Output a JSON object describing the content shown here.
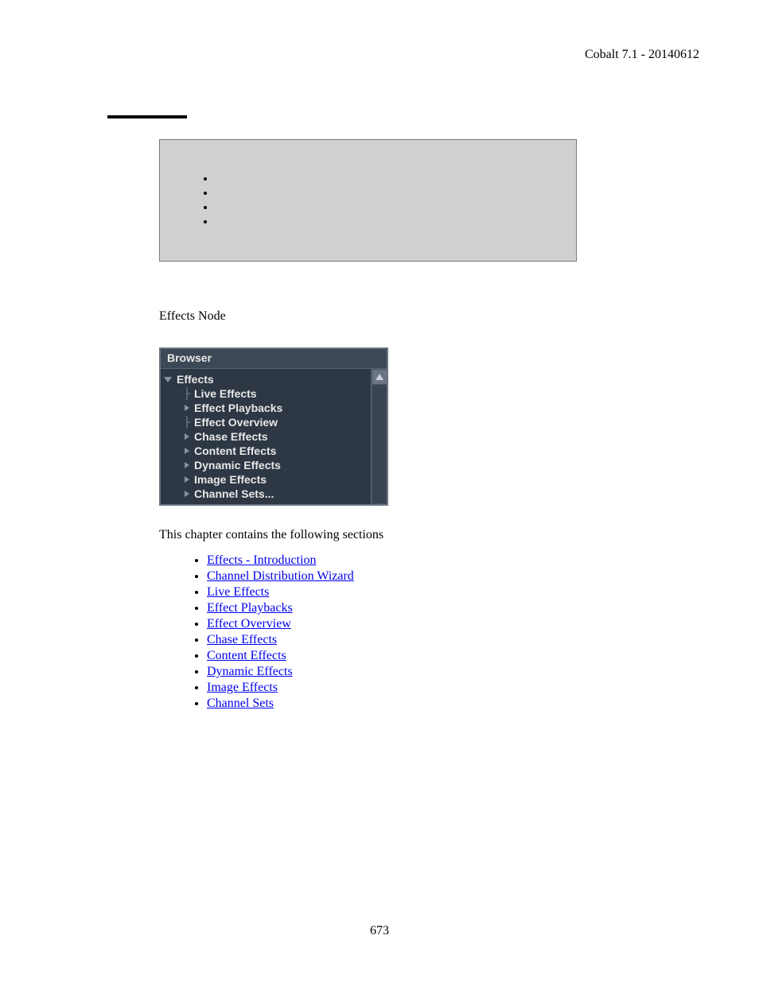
{
  "header": {
    "version_text": "Cobalt 7.1 - 20140612"
  },
  "body": {
    "effects_node_label": "Effects Node",
    "sections_intro": "This chapter contains the following sections"
  },
  "browser": {
    "title": "Browser",
    "root_label": "Effects",
    "items": [
      {
        "label": "Live Effects",
        "expandable": false
      },
      {
        "label": "Effect Playbacks",
        "expandable": true
      },
      {
        "label": "Effect Overview",
        "expandable": false
      },
      {
        "label": "Chase Effects",
        "expandable": true
      },
      {
        "label": "Content Effects",
        "expandable": true
      },
      {
        "label": "Dynamic Effects",
        "expandable": true
      },
      {
        "label": "Image Effects",
        "expandable": true
      },
      {
        "label": "Channel Sets...",
        "expandable": true
      }
    ]
  },
  "links": [
    "Effects - Introduction",
    "Channel Distribution Wizard",
    "Live Effects",
    "Effect Playbacks",
    "Effect Overview",
    "Chase Effects",
    "Content Effects",
    "Dynamic Effects",
    "Image Effects",
    "Channel Sets"
  ],
  "page_number": "673"
}
